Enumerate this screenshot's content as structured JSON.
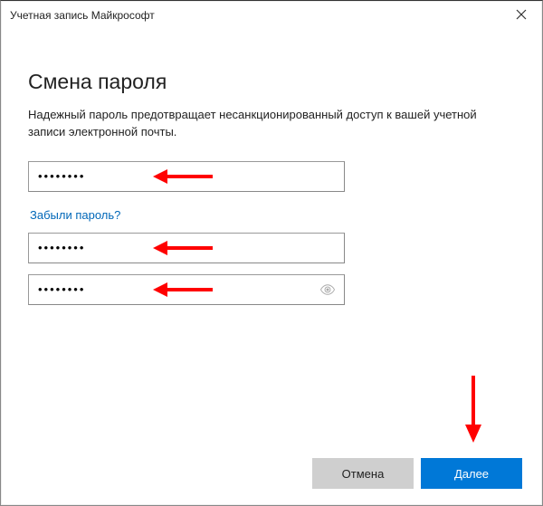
{
  "window": {
    "title": "Учетная запись Майкрософт"
  },
  "header": {
    "heading": "Смена пароля",
    "description": "Надежный пароль предотвращает несанкционированный доступ к вашей учетной записи электронной почты."
  },
  "fields": {
    "old_password_value": "••••••••",
    "new_password_value": "••••••••",
    "confirm_password_value": "••••••••"
  },
  "link": {
    "forgot_label": "Забыли пароль?"
  },
  "footer": {
    "cancel_label": "Отмена",
    "next_label": "Далее"
  },
  "colors": {
    "accent": "#0078d7",
    "arrow": "#ff0000"
  }
}
